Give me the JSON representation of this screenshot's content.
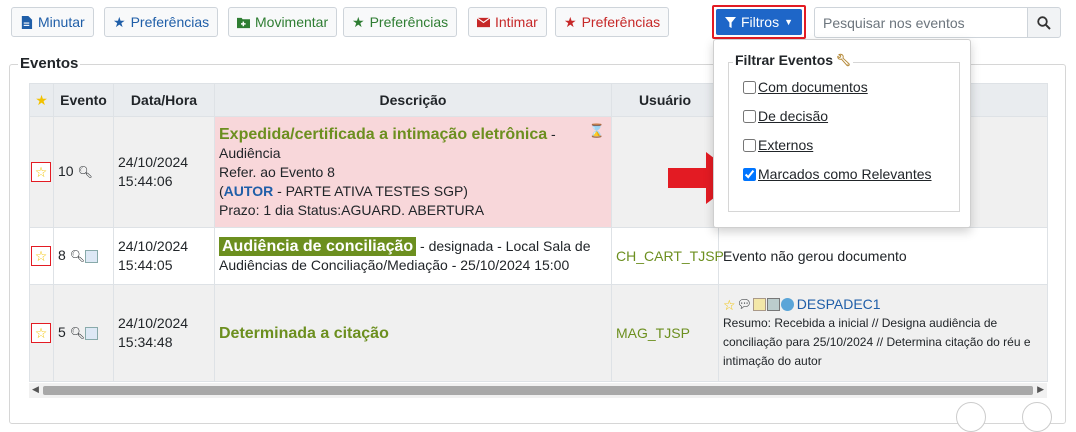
{
  "toolbar": {
    "minutar": "Minutar",
    "pref1": "Preferências",
    "movimentar": "Movimentar",
    "pref2": "Preferências",
    "intimar": "Intimar",
    "pref3": "Preferências",
    "filtros": "Filtros",
    "search_placeholder": "Pesquisar nos eventos"
  },
  "section": {
    "legend": "Eventos"
  },
  "table": {
    "headers": {
      "event": "Evento",
      "datetime": "Data/Hora",
      "desc": "Descrição",
      "user": "Usuário"
    },
    "rows": [
      {
        "num": "10",
        "date": "24/10/2024",
        "time": "15:44:06",
        "title": "Expedida/certificada a intimação eletrônica",
        "title_suffix": " - ",
        "lines": [
          "Audiência",
          "Refer. ao Evento 8"
        ],
        "autor_open": "(",
        "autor": "AUTOR",
        "autor_rest": " - PARTE ATIVA TESTES SGP)",
        "prazo": "Prazo: 1 dia Status:AGUARD. ABERTURA"
      },
      {
        "num": "8",
        "date": "24/10/2024",
        "time": "15:44:05",
        "title": "Audiência de conciliação",
        "rest": " - designada - Local Sala de Audiências de Conciliação/Mediação - 25/10/2024 15:00",
        "user": "CH_CART_TJSP",
        "doc": "Evento não gerou documento"
      },
      {
        "num": "5",
        "date": "24/10/2024",
        "time": "15:34:48",
        "title": "Determinada a citação",
        "user": "MAG_TJSP",
        "doc_link": "DESPADEC1",
        "summary": "Resumo: Recebida a inicial // Designa audiência de conciliação para 25/10/2024 // Determina citação do réu e intimação do autor"
      }
    ]
  },
  "dropdown": {
    "title": "Filtrar Eventos",
    "items": [
      {
        "label": "Com documentos",
        "checked": false
      },
      {
        "label": "De decisão",
        "checked": false
      },
      {
        "label": "Externos",
        "checked": false
      },
      {
        "label": "Marcados como Relevantes",
        "checked": true
      }
    ]
  },
  "colors": {
    "accent": "#1e66c8",
    "highlight_red": "#e31b23",
    "event_green": "#6c8f1f",
    "row_pink": "#f8d7da"
  }
}
